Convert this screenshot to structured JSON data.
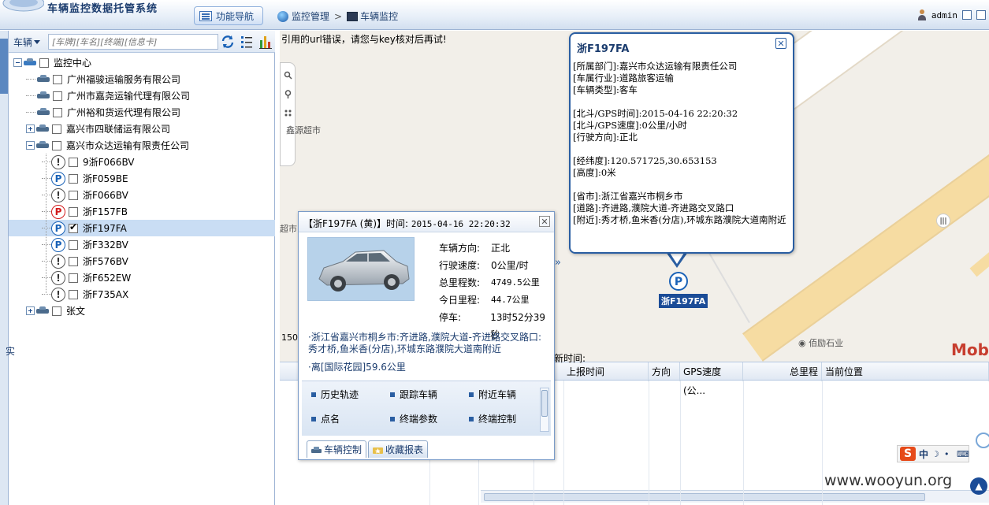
{
  "header": {
    "app_title": "车辆监控数据托管系统",
    "nav_tab_label": "功能导航",
    "breadcrumb": [
      "监控管理",
      "车辆监控"
    ],
    "user": "admin"
  },
  "search": {
    "type_label": "车辆",
    "placeholder": "[车牌][车名][终端][信息卡]"
  },
  "tree": {
    "root": "监控中心",
    "companies": [
      {
        "name": "广州福骏运输服务有限公司",
        "expanded": false,
        "has_children": false
      },
      {
        "name": "广州市嘉尧运输代理有限公司",
        "expanded": false,
        "has_children": false
      },
      {
        "name": "广州裕和货运代理有限公司",
        "expanded": false,
        "has_children": false
      },
      {
        "name": "嘉兴市四联储运有限公司",
        "expanded": false,
        "has_children": true
      },
      {
        "name": "嘉兴市众达运输有限责任公司",
        "expanded": true,
        "has_children": true
      }
    ],
    "vehicles": [
      {
        "plate": "9浙F066BV",
        "status": "warn",
        "checked": false
      },
      {
        "plate": "浙F059BE",
        "status": "park",
        "checked": false
      },
      {
        "plate": "浙F066BV",
        "status": "warn",
        "checked": false
      },
      {
        "plate": "浙F157FB",
        "status": "park-red",
        "checked": false
      },
      {
        "plate": "浙F197FA",
        "status": "park",
        "checked": true,
        "selected": true
      },
      {
        "plate": "浙F332BV",
        "status": "park",
        "checked": false
      },
      {
        "plate": "浙F576BV",
        "status": "warn",
        "checked": false
      },
      {
        "plate": "浙F652EW",
        "status": "warn",
        "checked": false
      },
      {
        "plate": "浙F735AX",
        "status": "warn",
        "checked": false
      }
    ],
    "last": "张文",
    "status_glyphs": {
      "warn": "!",
      "park": "P",
      "park-red": "P"
    }
  },
  "map": {
    "error": "引用的url错误，请您与key核对后再试!",
    "labels": {
      "xinyuan": "鑫源超市",
      "shi": "超市",
      "beili": "佰励石业",
      "scale": "150"
    },
    "logo": "Mob",
    "marker_label": "浙F197FA",
    "marker_glyph": "P"
  },
  "info_popup": {
    "title": "浙F197FA",
    "lines": [
      "[所属部门]:嘉兴市众达运输有限责任公司",
      "[车属行业]:道路旅客运输",
      "[车辆类型]:客车",
      "",
      "[北斗/GPS时间]:2015-04-16 22:20:32",
      "[北斗/GPS速度]:0公里/小时",
      "[行驶方向]:正北",
      "",
      "[经纬度]:120.571725,30.653153",
      "[高度]:0米",
      "",
      "[省市]:浙江省嘉兴市桐乡市",
      "[道路]:齐进路,濮院大道-齐进路交叉路口",
      "[附近]:秀才桥,鱼米香(分店),环城东路濮院大道南附近"
    ]
  },
  "detail_popup": {
    "title_prefix": "【浙F197FA  (黄)】时间:",
    "time": "2015-04-16  22:20:32",
    "stats": [
      {
        "key": "车辆方向:",
        "val": "正北",
        "mono": false
      },
      {
        "key": "行驶速度:",
        "val": "0公里/时",
        "mono": false
      },
      {
        "key": "总里程数:",
        "val": "4749.5公里",
        "mono": true
      },
      {
        "key": "今日里程:",
        "val": "44.7公里",
        "mono": true
      },
      {
        "key": "停车:",
        "val": "13时52分39秒",
        "mono": false
      }
    ],
    "address": "·浙江省嘉兴市桐乡市:齐进路,濮院大道-齐进路交叉路口:秀才桥,鱼米香(分店),环城东路濮院大道南附近",
    "distance": "·离[国际花园]59.6公里",
    "actions": [
      "历史轨迹",
      "跟踪车辆",
      "附近车辆",
      "点名",
      "终端参数",
      "终端控制"
    ],
    "tabs": [
      "车辆控制",
      "收藏报表"
    ]
  },
  "grid": {
    "tab_label": "实",
    "time_label": "新时间:",
    "columns": [
      "上报时间",
      "方向",
      "GPS速度(公...",
      "总里程",
      "当前位置"
    ]
  },
  "ime": {
    "logo": "S",
    "lang": "中"
  },
  "watermark": "www.wooyun.org"
}
